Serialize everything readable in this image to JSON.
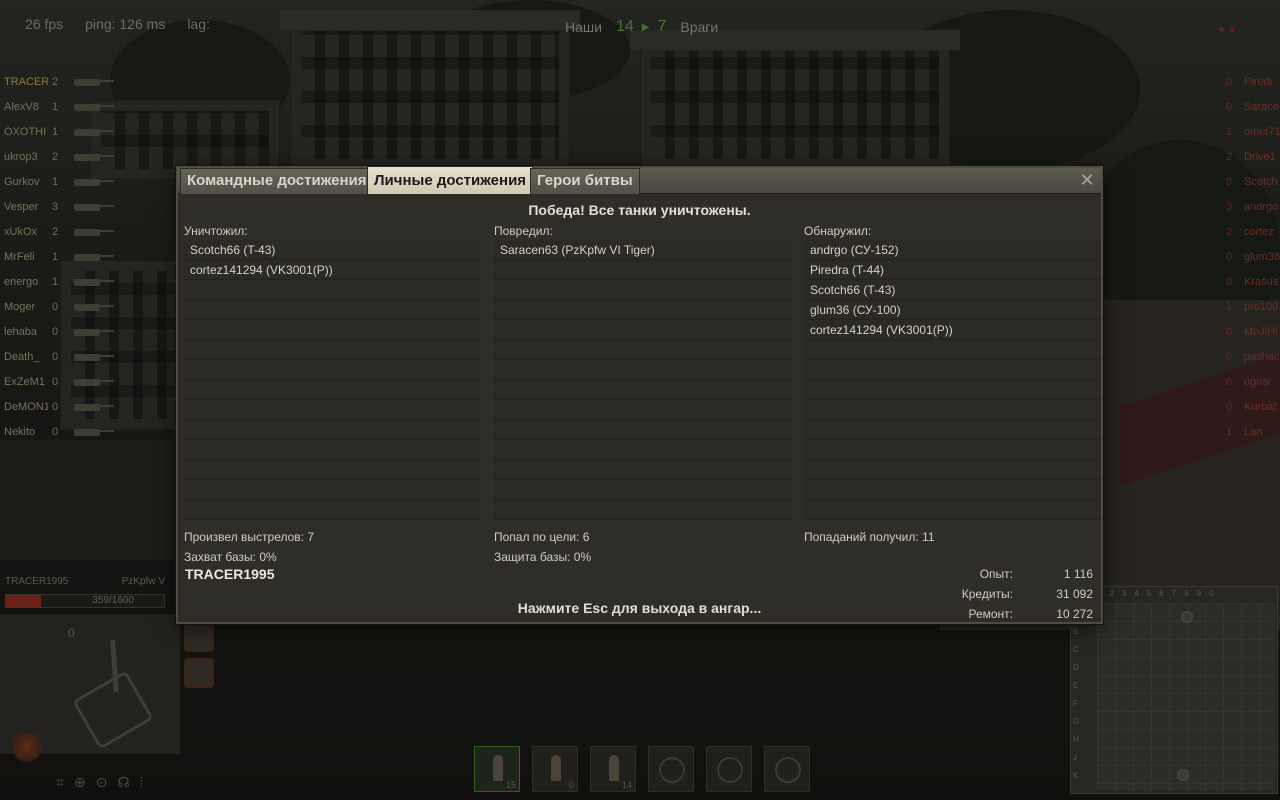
{
  "hud": {
    "fps": "26 fps",
    "ping": "ping: 126 ms",
    "lag": "lag:",
    "allies_label": "Наши",
    "allies_score": "14",
    "enemies_score": "7",
    "enemies_label": "Враги"
  },
  "team_allies": [
    {
      "name": "TRACER",
      "frags": "2"
    },
    {
      "name": "AlexV8",
      "frags": "1"
    },
    {
      "name": "OXOTHI",
      "frags": "1"
    },
    {
      "name": "ukrop3",
      "frags": "2"
    },
    {
      "name": "Gurkov",
      "frags": "1"
    },
    {
      "name": "Vesper",
      "frags": "3"
    },
    {
      "name": "xUkOx",
      "frags": "2"
    },
    {
      "name": "MrFeli",
      "frags": "1"
    },
    {
      "name": "energo",
      "frags": "1"
    },
    {
      "name": "Moger",
      "frags": "0"
    },
    {
      "name": "lehaba",
      "frags": "0"
    },
    {
      "name": "Death_",
      "frags": "0"
    },
    {
      "name": "ExZeM1",
      "frags": "0"
    },
    {
      "name": "DeMON1",
      "frags": "0"
    },
    {
      "name": "Nekito",
      "frags": "0"
    }
  ],
  "team_enemies": [
    {
      "name": "Piredr",
      "frags": "0"
    },
    {
      "name": "Sarace",
      "frags": "0"
    },
    {
      "name": "omut71",
      "frags": "1"
    },
    {
      "name": "Drive1",
      "frags": "2"
    },
    {
      "name": "Scotch",
      "frags": "0"
    },
    {
      "name": "andrgo",
      "frags": "3"
    },
    {
      "name": "cortez",
      "frags": "2"
    },
    {
      "name": "glum36",
      "frags": "0"
    },
    {
      "name": "Krasus",
      "frags": "0"
    },
    {
      "name": "pro100",
      "frags": "1"
    },
    {
      "name": "MoJlHi",
      "frags": "0"
    },
    {
      "name": "pashac",
      "frags": "0"
    },
    {
      "name": "ugnsi",
      "frags": "0"
    },
    {
      "name": "Kurbat",
      "frags": "0"
    },
    {
      "name": "Lan",
      "frags": "1"
    }
  ],
  "vehicle": {
    "player": "TRACER1995",
    "tank": "PzKpfw V",
    "hp_text": "359/1600",
    "hp_fraction": 0.224,
    "speed": "0"
  },
  "ammo": [
    {
      "count": "15",
      "active": true
    },
    {
      "count": "0",
      "active": false
    },
    {
      "count": "14",
      "active": false
    },
    {
      "count": "",
      "active": false
    },
    {
      "count": "",
      "active": false
    },
    {
      "count": "",
      "active": false
    }
  ],
  "minimap": {
    "cols": [
      "1",
      "2",
      "3",
      "4",
      "5",
      "6",
      "7",
      "8",
      "9",
      "0"
    ],
    "rows": [
      "A",
      "B",
      "C",
      "D",
      "E",
      "F",
      "G",
      "H",
      "J",
      "K"
    ]
  },
  "dialog": {
    "tabs": [
      "Командные достижения",
      "Личные достижения",
      "Герои битвы"
    ],
    "active_tab": 1,
    "title": "Победа! Все танки уничтожены.",
    "destroyed_label": "Уничтожил:",
    "destroyed": [
      "Scotch66 (T-43)",
      "cortez141294 (VK3001(P))"
    ],
    "damaged_label": "Повредил:",
    "damaged": [
      "Saracen63 (PzKpfw VI Tiger)"
    ],
    "spotted_label": "Обнаружил:",
    "spotted": [
      "andrgo (СУ-152)",
      "Piredra (T-44)",
      "Scotch66 (T-43)",
      "glum36 (СУ-100)",
      "cortez141294 (VK3001(P))"
    ],
    "shots_fired": "Произвел выстрелов: 7",
    "hits": "Попал по цели: 6",
    "hits_received": "Попаданий получил: 11",
    "base_capture": "Захват базы: 0%",
    "base_defense": "Защита базы: 0%",
    "player_name": "TRACER1995",
    "esc_hint": "Нажмите Esc для выхода в ангар...",
    "rewards": [
      {
        "label": "Опыт:",
        "value": "1 116"
      },
      {
        "label": "Кредиты:",
        "value": "31 092"
      },
      {
        "label": "Ремонт:",
        "value": "10 272"
      }
    ]
  }
}
